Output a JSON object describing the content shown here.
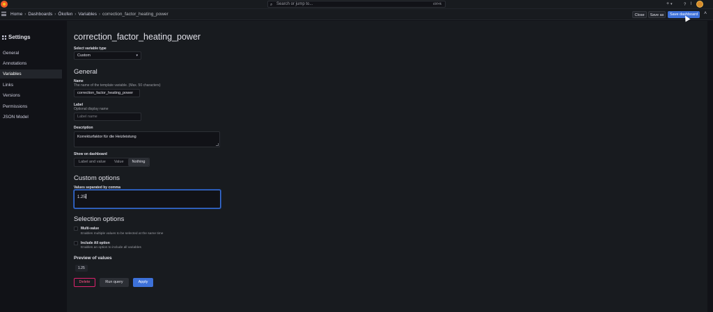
{
  "topbar": {
    "search_placeholder": "Search or jump to...",
    "search_shortcut": "ctrl+k",
    "plus_label": "+",
    "help_icon": "help-icon",
    "news_icon": "rss-icon"
  },
  "breadcrumb": {
    "items": [
      "Home",
      "Dashboards",
      "Ökofen",
      "Variables",
      "correction_factor_heating_power"
    ]
  },
  "header_actions": {
    "close": "Close",
    "save_as": "Save as",
    "save_dashboard": "Save dashboard"
  },
  "sidebar": {
    "title": "Settings",
    "items": [
      {
        "label": "General",
        "active": false
      },
      {
        "label": "Annotations",
        "active": false
      },
      {
        "label": "Variables",
        "active": true
      },
      {
        "label": "Links",
        "active": false
      },
      {
        "label": "Versions",
        "active": false
      },
      {
        "label": "Permissions",
        "active": false
      },
      {
        "label": "JSON Model",
        "active": false
      }
    ]
  },
  "editor": {
    "title": "correction_factor_heating_power",
    "type_label": "Select variable type",
    "type_value": "Custom",
    "general_heading": "General",
    "name_label": "Name",
    "name_desc": "The name of the template variable. (Max. 50 characters)",
    "name_value": "correction_factor_heating_power",
    "label_label": "Label",
    "label_desc": "Optional display name",
    "label_placeholder": "Label name",
    "description_label": "Description",
    "description_value": "Korrekturfaktor für die Heizleistung",
    "show_label": "Show on dashboard",
    "show_options": [
      "Label and value",
      "Value",
      "Nothing"
    ],
    "show_selected": "Nothing",
    "custom_heading": "Custom options",
    "values_label": "Values separated by comma",
    "values_value": "1.25",
    "selection_heading": "Selection options",
    "multi_label": "Multi-value",
    "multi_desc": "Enables multiple values to be selected at the same time",
    "multi_checked": false,
    "all_label": "Include All option",
    "all_desc": "Enables an option to include all variables",
    "all_checked": false,
    "preview_heading": "Preview of values",
    "preview_values": [
      "1.25"
    ],
    "delete_label": "Delete",
    "run_query_label": "Run query",
    "apply_label": "Apply"
  },
  "colors": {
    "primary": "#3d71d9",
    "danger": "#e0226e",
    "background": "#181b1f"
  }
}
